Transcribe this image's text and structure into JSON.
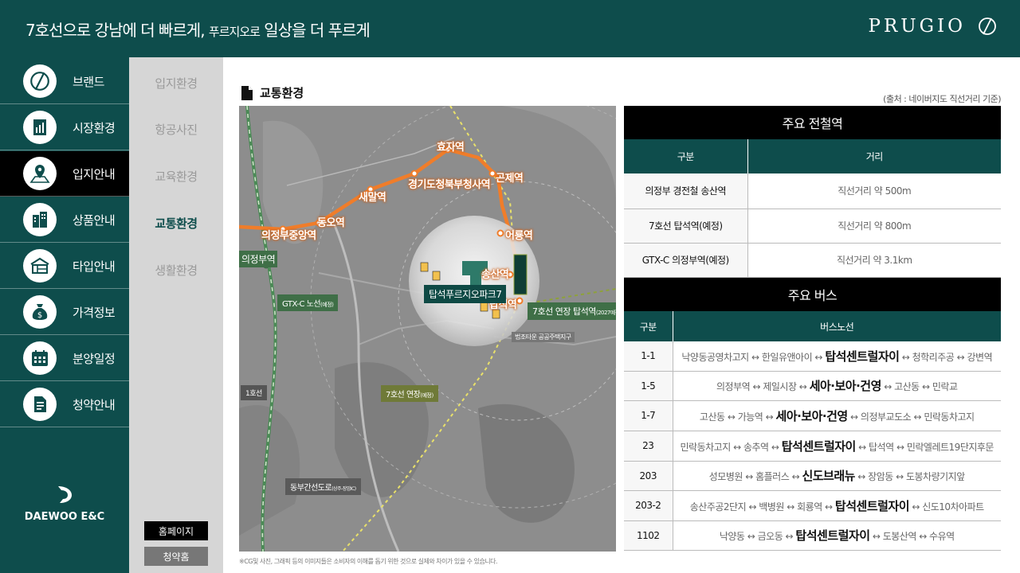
{
  "header": {
    "title_part1": "7호선으로",
    "title_part2": " 강남에 더 빠르게, ",
    "title_part3": "푸르지오로",
    "title_part4": " 일상을 더 푸르게",
    "logo": "PRUGIO"
  },
  "sidebar": {
    "items": [
      {
        "label": "브랜드",
        "icon": "brand-icon"
      },
      {
        "label": "시장환경",
        "icon": "market-chart-icon"
      },
      {
        "label": "입지안내",
        "icon": "location-map-icon"
      },
      {
        "label": "상품안내",
        "icon": "building-icon"
      },
      {
        "label": "타입안내",
        "icon": "floorplan-icon"
      },
      {
        "label": "가격정보",
        "icon": "money-bag-icon"
      },
      {
        "label": "분양일정",
        "icon": "calendar-icon"
      },
      {
        "label": "청약안내",
        "icon": "document-icon"
      }
    ],
    "active_index": 2,
    "footer_brand": "DAEWOO E&C"
  },
  "subnav": {
    "items": [
      "입지환경",
      "항공사진",
      "교육환경",
      "교통환경",
      "생활환경"
    ],
    "active_index": 3,
    "homepage_button": "홈페이지",
    "subscription_button": "청약홈"
  },
  "main": {
    "section_title": "교통환경",
    "source_note": "(출처 : 네이버지도 직선거리 기준)",
    "disclaimer": "※CG및 사진, 그래픽 등의 이미지들은 소비자의 이해를 돕기 위한 것으로 실제와 차이가 있을 수 있습니다."
  },
  "map": {
    "stations": [
      "효자역",
      "경기도청북부청사역",
      "곤제역",
      "새말역",
      "동오역",
      "의정부중앙역",
      "어룡역",
      "송산역",
      "탑석역",
      "의정부역"
    ],
    "complex_label": "탑석푸르지오파크7",
    "line7_ext_label": "7호선 연장 탑석역",
    "line7_ext_label_note": "(2027예정)",
    "gtx_label": "GTX-C 노선",
    "gtx_note": "(예정)",
    "line7_label": "7호선 연장",
    "line7_note": "(예정)",
    "line1_label": "1호선",
    "road_label": "동부간선도로",
    "road_note": "(상주-장암IC)",
    "district_label": "법조타운 공공주택지구"
  },
  "rail_table": {
    "title": "주요 전철역",
    "headers": [
      "구분",
      "거리"
    ],
    "rows": [
      [
        "의정부 경전철 송산역",
        "직선거리 약 500m"
      ],
      [
        "7호선 탑석역(예정)",
        "직선거리 약 800m"
      ],
      [
        "GTX-C 의정부역(예정)",
        "직선거리 약 3.1km"
      ]
    ]
  },
  "bus_table": {
    "title": "주요 버스",
    "headers": [
      "구분",
      "버스노선"
    ],
    "rows": [
      {
        "no": "1-1",
        "pre": "낙양동공영차고지 ↔ 한일유앤아이 ↔ ",
        "big": "탑석센트럴자이",
        "post": " ↔ 청학리주공 ↔ 강변역"
      },
      {
        "no": "1-5",
        "pre": "의정부역 ↔ 제일시장 ↔ ",
        "big": "세아·보아·건영",
        "post": " ↔ 고산동 ↔ 민락교"
      },
      {
        "no": "1-7",
        "pre": "고산동 ↔ 가능역 ↔ ",
        "big": "세아·보아·건영",
        "post": " ↔ 의정부교도소 ↔ 민락동차고지"
      },
      {
        "no": "23",
        "pre": "민락동차고지 ↔ 송추역 ↔ ",
        "big": "탑석센트럴자이",
        "post": " ↔ 탑석역 ↔ 민락엘레트19단지후문"
      },
      {
        "no": "203",
        "pre": "성모병원 ↔ 홈플러스 ↔ ",
        "big": "신도브래뉴",
        "post": " ↔ 장암동 ↔ 도봉차량기지앞"
      },
      {
        "no": "203-2",
        "pre": "송산주공2단지 ↔ 백병원 ↔ 회룡역 ↔ ",
        "big": "탑석센트럴자이",
        "post": " ↔ 신도10차아파트"
      },
      {
        "no": "1102",
        "pre": "낙양동 ↔ 금오동 ↔ ",
        "big": "탑석센트럴자이",
        "post": " ↔ 도봉산역 ↔ 수유역"
      }
    ]
  },
  "colors": {
    "brand_teal": "#0e4d4c",
    "line_orange": "#f07d2a",
    "gtx_green": "#3f6f47",
    "line7_olive": "#8ea23a"
  }
}
